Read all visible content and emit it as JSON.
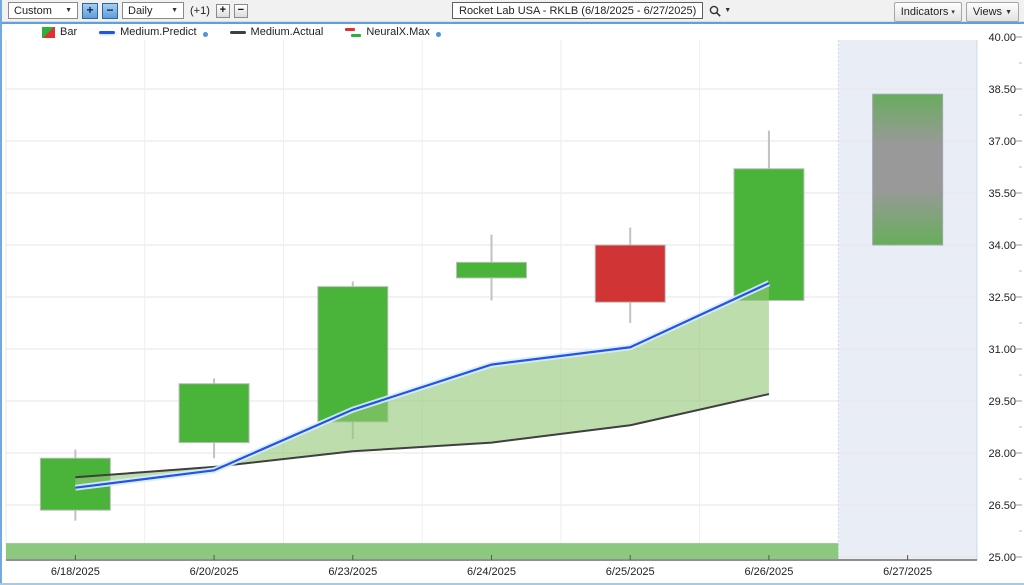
{
  "toolbar": {
    "range_select": "Custom",
    "plus": "+",
    "minus": "−",
    "period_select": "Daily",
    "offset": "(+1)",
    "small_plus": "+",
    "small_minus": "−",
    "symbol_title": "Rocket Lab USA - RKLB (6/18/2025 - 6/27/2025)",
    "indicators": "Indicators",
    "views": "Views"
  },
  "legend": [
    {
      "label": "Bar"
    },
    {
      "label": "Medium.Predict"
    },
    {
      "label": "Medium.Actual"
    },
    {
      "label": "NeuralX.Max"
    }
  ],
  "colors": {
    "up": "#4ab43a",
    "down": "#d13434",
    "candle_border": "#bdbdbd",
    "wick": "#c2c2c2",
    "predict_line": "#2255e6",
    "predict_glow": "#d8ecff",
    "actual_line": "#3f3f3f",
    "band_fill": "rgba(146,199,118,0.6)",
    "forecast_bg": "#e9eef6",
    "forecast_green": "#68ad5c",
    "forecast_gray": "#9a999a",
    "forecast_border": "#a0a6ad",
    "bottom_band": "#8cc97e",
    "grid_h": "#e6e6e6",
    "grid_v": "#eeeeee",
    "forecast_boundary": "#c9daec",
    "axis_line": "#6b6b6b",
    "axis_text": "#222222"
  },
  "chart_data": {
    "type": "candlestick+line",
    "title": "Rocket Lab USA - RKLB (6/18/2025 - 6/27/2025)",
    "x_labels": [
      "6/18/2025",
      "6/20/2025",
      "6/23/2025",
      "6/24/2025",
      "6/25/2025",
      "6/26/2025",
      "6/27/2025"
    ],
    "y_ticks": [
      25.0,
      26.5,
      28.0,
      29.5,
      31.0,
      32.5,
      34.0,
      35.5,
      37.0,
      38.5,
      40.0
    ],
    "ylim": [
      25,
      40
    ],
    "grid": true,
    "legend_position": "top-left",
    "candles": [
      {
        "date": "6/18/2025",
        "open": 26.35,
        "close": 27.85,
        "high": 28.1,
        "low": 26.05,
        "dir": "up"
      },
      {
        "date": "6/20/2025",
        "open": 28.3,
        "close": 30.0,
        "high": 30.15,
        "low": 27.85,
        "dir": "up"
      },
      {
        "date": "6/23/2025",
        "open": 28.9,
        "close": 32.8,
        "high": 32.95,
        "low": 28.4,
        "dir": "up"
      },
      {
        "date": "6/24/2025",
        "open": 33.05,
        "close": 33.5,
        "high": 34.3,
        "low": 32.4,
        "dir": "up"
      },
      {
        "date": "6/25/2025",
        "open": 34.0,
        "close": 32.35,
        "high": 34.5,
        "low": 31.75,
        "dir": "down"
      },
      {
        "date": "6/26/2025",
        "open": 32.4,
        "close": 36.2,
        "high": 37.3,
        "low": 32.4,
        "dir": "up"
      }
    ],
    "forecast_bar": {
      "date": "6/27/2025",
      "top": 38.35,
      "bottom": 34.0
    },
    "series": [
      {
        "name": "Medium.Predict",
        "values": [
          27.0,
          27.5,
          29.25,
          30.55,
          31.05,
          32.9
        ]
      },
      {
        "name": "Medium.Actual",
        "values": [
          27.3,
          27.6,
          28.05,
          28.3,
          28.8,
          29.7
        ]
      }
    ],
    "band_between": [
      "Medium.Predict",
      "Medium.Actual"
    ],
    "bottom_band_range": [
      25.0,
      25.4
    ],
    "forecast_region_start_label": "6/27/2025"
  }
}
